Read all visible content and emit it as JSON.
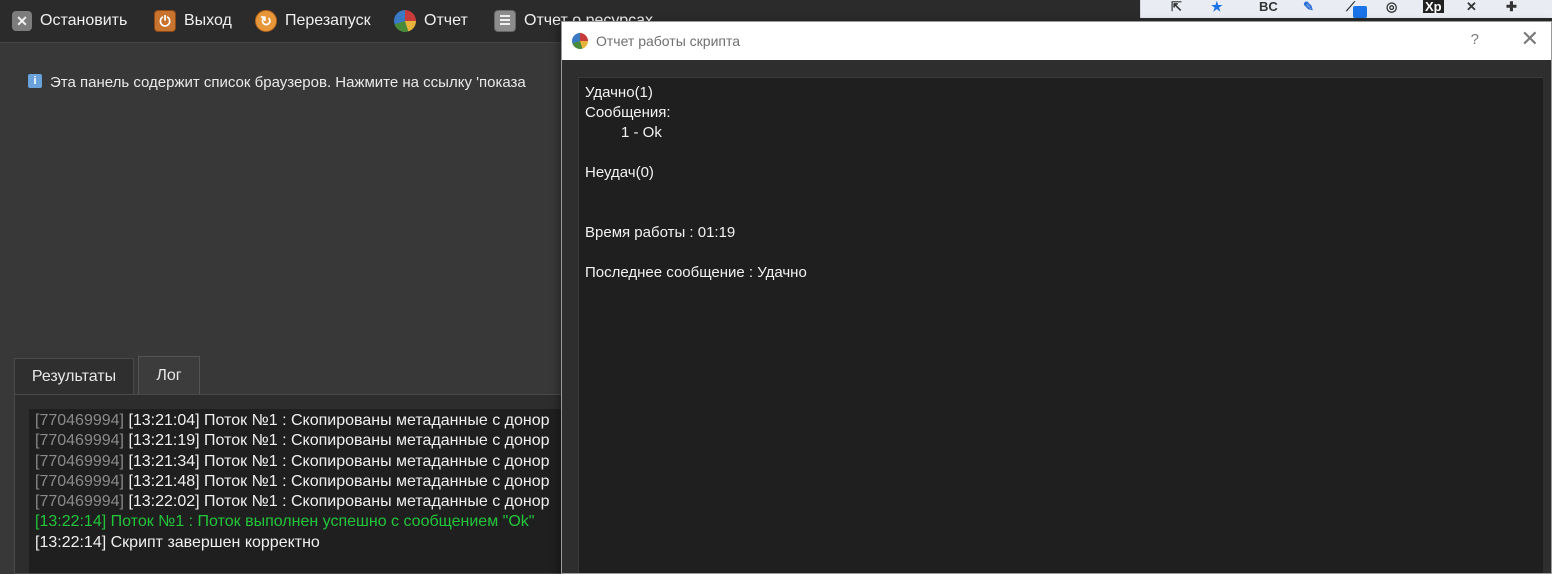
{
  "toolbar": {
    "stop": "Остановить",
    "exit": "Выход",
    "restart": "Перезапуск",
    "report": "Отчет",
    "resources": "Отчет о ресурсах"
  },
  "browser_strip": {
    "icons": [
      "share-icon",
      "bookmark-star-icon",
      "bc-extension-icon",
      "extension-icon",
      "extension-icon",
      "extension-icon",
      "xp-extension-icon",
      "tools-icon",
      "puzzle-icon"
    ],
    "labels": {
      "bc": "BC",
      "xp": "Xp"
    }
  },
  "info": {
    "text": "Эта панель содержит список браузеров. Нажмите на ссылку 'показа"
  },
  "tabs": [
    {
      "label": "Результаты"
    },
    {
      "label": "Лог"
    }
  ],
  "log": [
    {
      "id": "[770469994]",
      "text": "[13:21:04] Поток №1 : Скопированы метаданные с донор"
    },
    {
      "id": "[770469994]",
      "text": "[13:21:19] Поток №1 : Скопированы метаданные с донор"
    },
    {
      "id": "[770469994]",
      "text": "[13:21:34] Поток №1 : Скопированы метаданные с донор"
    },
    {
      "id": "[770469994]",
      "text": "[13:21:48] Поток №1 : Скопированы метаданные с донор"
    },
    {
      "id": "[770469994]",
      "text": "[13:22:02] Поток №1 : Скопированы метаданные с донор"
    },
    {
      "id": "",
      "text": "[13:22:14] Поток №1 : Поток выполнен успешно с сообщением \"Ok\"",
      "color": "#23c63a"
    },
    {
      "id": "",
      "text": "[13:22:14] Скрипт завершен корректно"
    }
  ],
  "dialog": {
    "title": "Отчет работы скрипта",
    "help": "?",
    "close": "✕",
    "lines": [
      "Удачно(1)",
      "Сообщения:",
      "1 - Ok",
      "",
      "Неудач(0)",
      "",
      "",
      "Время работы : 01:19",
      "",
      "Последнее сообщение : Удачно"
    ]
  }
}
